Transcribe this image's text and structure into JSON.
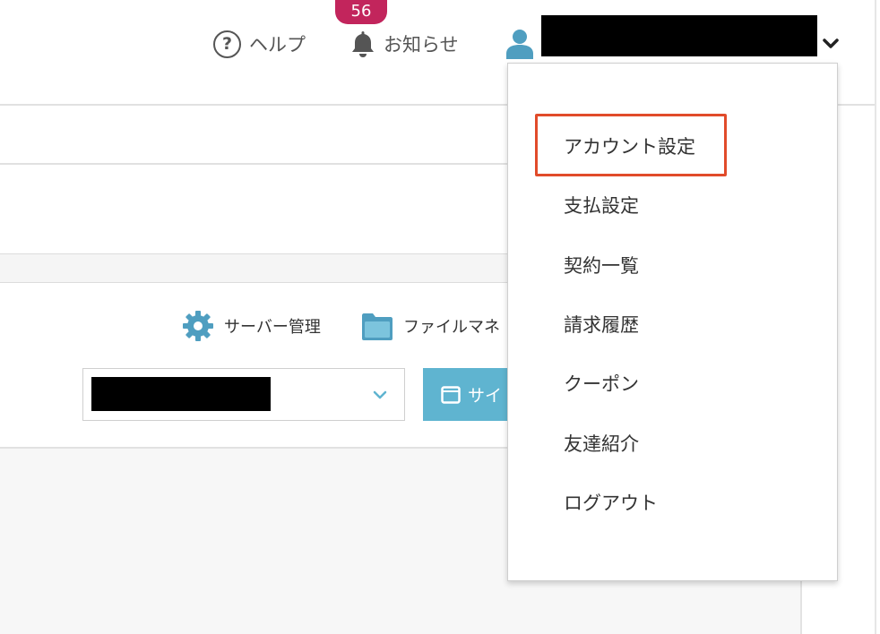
{
  "header": {
    "help_label": "ヘルプ",
    "notice_label": "お知らせ",
    "notice_count": "56",
    "user_name": ""
  },
  "toolbar": {
    "server_label": "サーバー管理",
    "file_label": "ファイルマネ",
    "select_value": "",
    "site_button_label": "サイ"
  },
  "dropdown": {
    "items": [
      {
        "label": "アカウント設定"
      },
      {
        "label": "支払設定"
      },
      {
        "label": "契約一覧"
      },
      {
        "label": "請求履歴"
      },
      {
        "label": "クーポン"
      },
      {
        "label": "友達紹介"
      },
      {
        "label": "ログアウト"
      }
    ]
  },
  "colors": {
    "badge": "#c2255c",
    "accent": "#5fb4d0",
    "highlight": "#e14b2a"
  },
  "icons": {
    "help": "question-circle-icon",
    "notice": "bell-icon",
    "user": "user-icon",
    "server": "gear-icon",
    "file": "folder-icon",
    "site": "window-icon",
    "chevron": "chevron-down-icon"
  }
}
